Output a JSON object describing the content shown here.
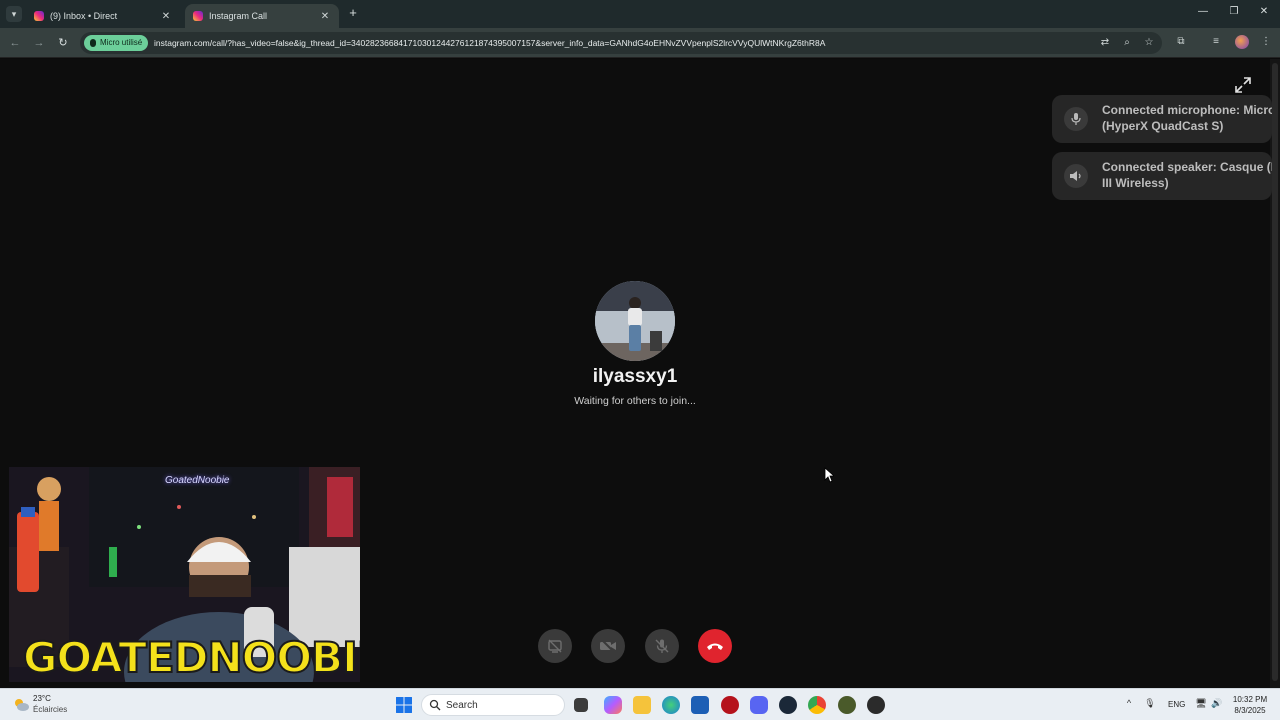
{
  "browser": {
    "tabs": [
      {
        "title": "(9) Inbox • Direct",
        "active": false
      },
      {
        "title": "Instagram Call",
        "active": true
      }
    ],
    "address_bar": {
      "mic_chip": "Micro utilisé",
      "url": "instagram.com/call/?has_video=false&ig_thread_id=340282366841710301244276121874395007157&server_info_data=GANhdG4oEHNvZVVpenplS2lrcVVyQUlWtNKrgZ6thR8A"
    }
  },
  "call": {
    "toasts": [
      {
        "text_line1": "Connected microphone: Micro",
        "text_line2": "(HyperX QuadCast S)",
        "icon": "microphone-icon"
      },
      {
        "text_line1": "Connected speaker: Casque (H",
        "text_line2": "III Wireless)",
        "icon": "speaker-icon"
      }
    ],
    "callee": {
      "username": "ilyassxy1",
      "status": "Waiting for others to join..."
    },
    "controls": [
      "screen-share-off-icon",
      "camera-off-icon",
      "microphone-off-icon",
      "end-call-icon"
    ]
  },
  "webcam_overlay": {
    "channel_tag": "GoatedNoobie",
    "banner": "GOATEDNOOBIE"
  },
  "taskbar": {
    "weather": {
      "temp": "23°C",
      "desc": "Éclaircies"
    },
    "search_label": "Search",
    "language": "ENG",
    "time": "10:32 PM",
    "date": "8/3/2025"
  },
  "colors": {
    "end_call": "#e0242e",
    "mic_chip": "#6ccf9a",
    "banner_yellow": "#f4e11b"
  }
}
